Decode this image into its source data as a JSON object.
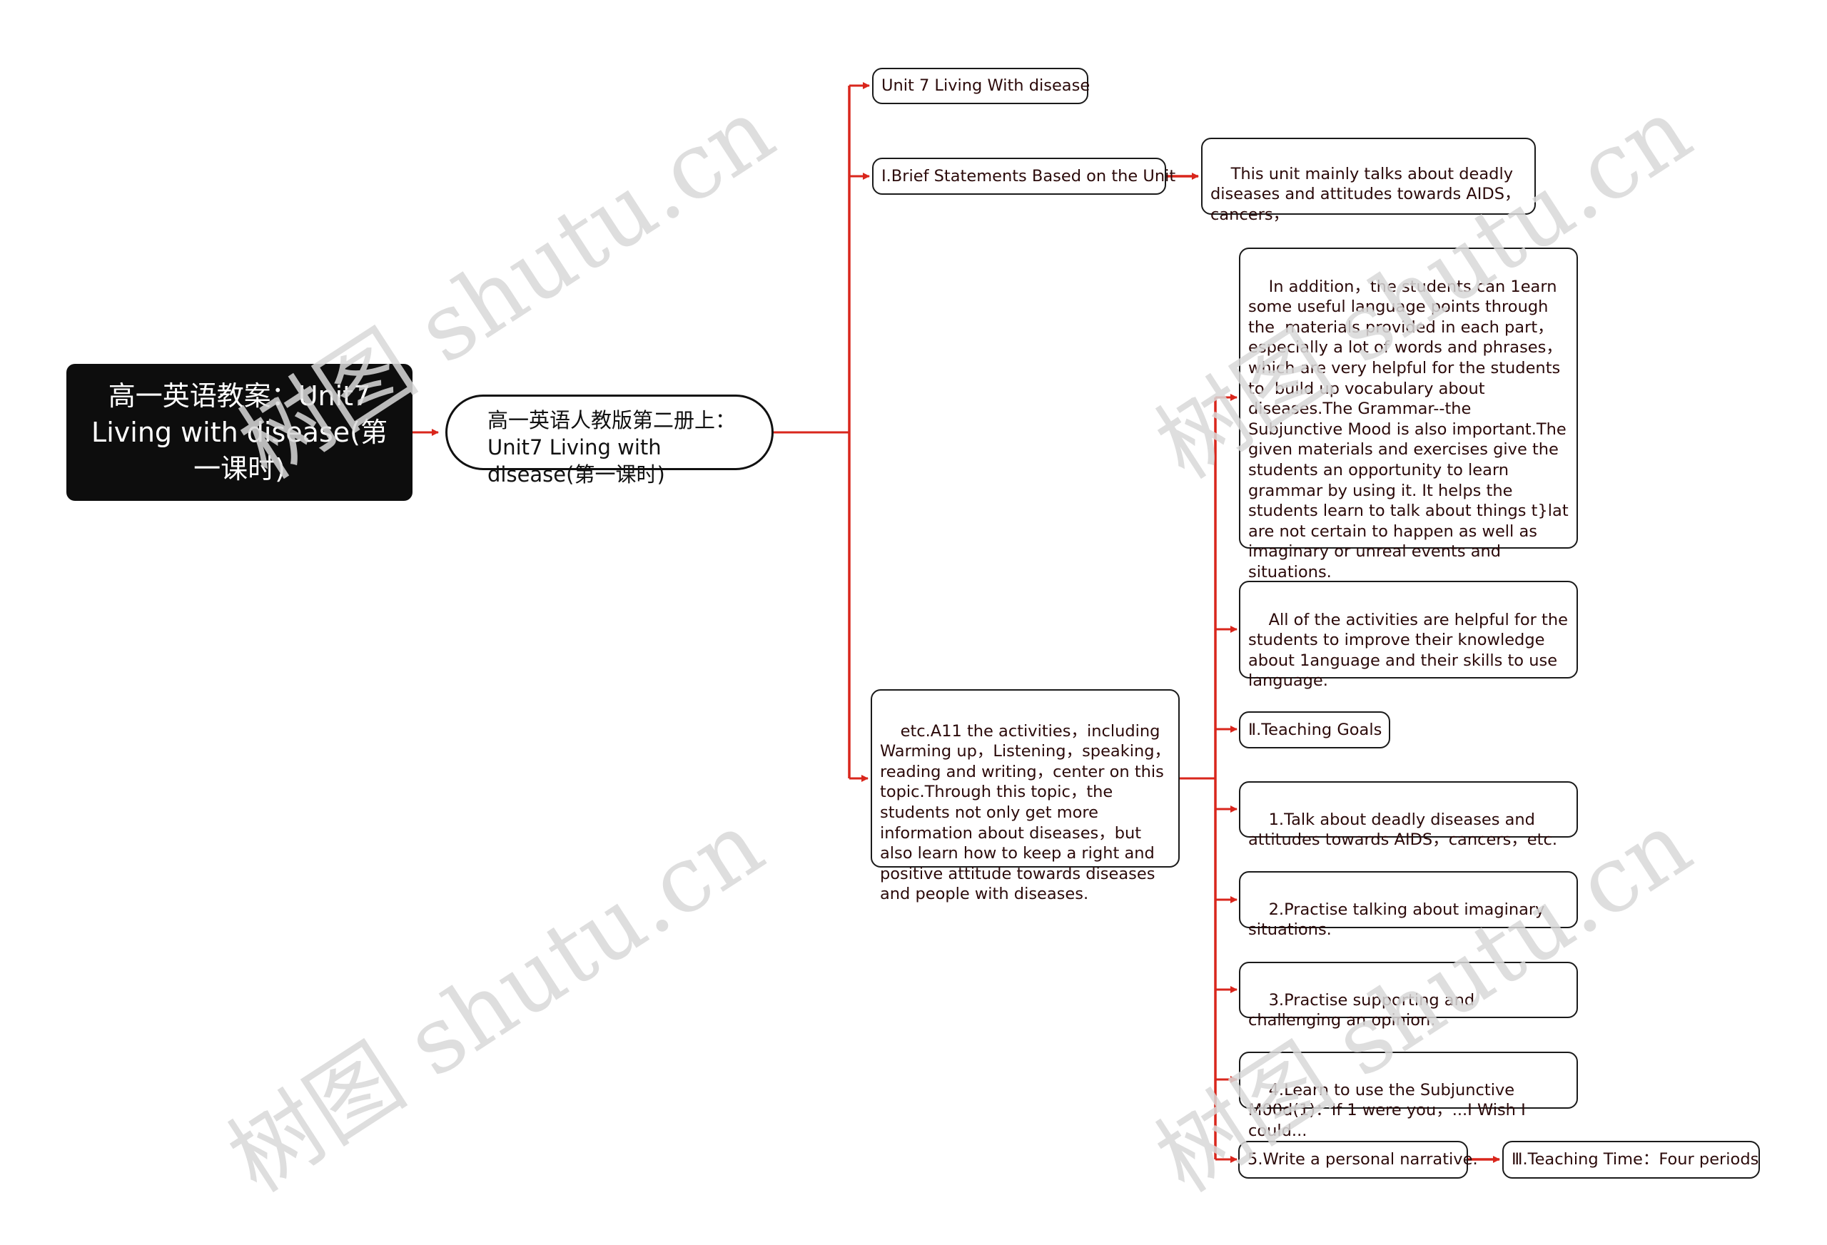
{
  "root": {
    "label": "高一英语教案：Unit7 Living with disease(第一课时)"
  },
  "topic": {
    "label": "高一英语人教版第二册上：Unit7 Living with disease(第一课时)"
  },
  "branches": {
    "unit_title": "Unit 7 Living With disease",
    "brief_statements": "I.Brief Statements Based on the Unit",
    "brief_detail": "This unit mainly talks about deadly diseases and attitudes towards AIDS，cancers，",
    "activities_summary": "etc.A11 the activities，including Warming up，Listening，speaking，reading and writing，center on this topic.Through this topic，the students not only get more information about diseases，but also learn how to keep a right and positive attitude towards diseases and people with diseases."
  },
  "activity_children": [
    "In addition，the students can 1earn some useful language points through the  materials provided in each part，especially a lot of words and phrases，which are very helpful for the students to  build up vocabulary about diseases.The Grammar--the Subjunctive Mood is also important.The given materials and exercises give the students an opportunity to learn grammar by using it. It helps the students learn to talk about things t}lat are not certain to happen as well as imaginary or unreal events and situations.",
    "All of the activities are helpful for the students to improve their knowledge about 1anguage and their skills to use language.",
    "Ⅱ.Teaching Goals",
    "1.Talk about deadly diseases and attitudes towards AIDS，cancers，etc.",
    "2.Practise talking about imaginary situations.",
    "3.Practise supporting and challenging an opinion.",
    "4.Learn to use the Subjunctive M00d(1)：If 1 were you，...I Wish I could...",
    "5.Write a personal narrative."
  ],
  "teaching_time": "Ⅲ.Teaching Time：Four periods",
  "watermark": "树图 shutu.cn",
  "colors": {
    "connector": "#d9261c",
    "root_bg": "#0d0d0d",
    "node_text": "#2b0a0a",
    "watermark": "#d9d9d9"
  }
}
